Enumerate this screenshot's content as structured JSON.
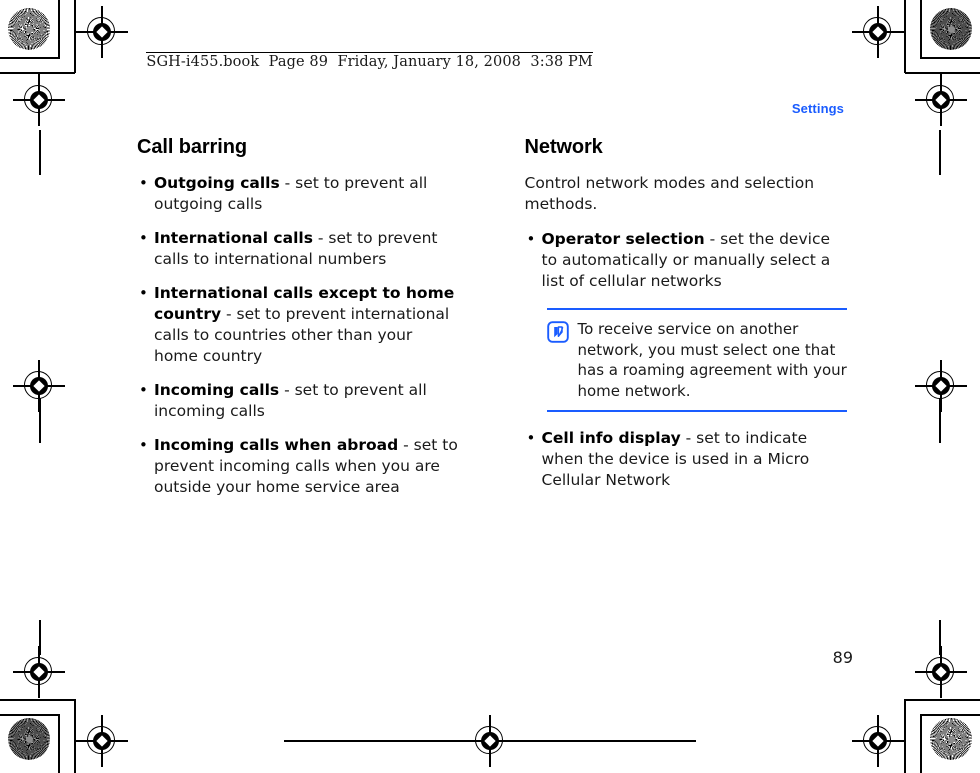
{
  "page": {
    "book_header": "SGH-i455.book  Page 89  Friday, January 18, 2008  3:38 PM",
    "section_label": "Settings",
    "folio": "89"
  },
  "columns": [
    {
      "title": "Call barring",
      "bullets": [
        {
          "term": "Outgoing calls",
          "rest": " - set to prevent all outgoing calls"
        },
        {
          "term": "International calls",
          "rest": " - set to prevent calls to international numbers"
        },
        {
          "term": "International calls except to home country",
          "rest": " - set to prevent international calls to countries other than your home country"
        },
        {
          "term": "Incoming calls",
          "rest": " - set to prevent all incoming calls"
        },
        {
          "term": "Incoming calls when abroad",
          "rest": " - set to prevent incoming calls when you are outside your home service area"
        }
      ]
    },
    {
      "title": "Network",
      "intro": "Control network modes and selection methods.",
      "bullets_before_note": [
        {
          "term": "Operator selection",
          "rest": " - set the device to automatically or manually select a list of cellular networks"
        }
      ],
      "note": {
        "icon": "note-pen-icon",
        "text": "To receive service on another network, you must select one that has a roaming agreement with your home network."
      },
      "bullets_after_note": [
        {
          "term": "Cell info display",
          "rest": " - set to indicate when the device is used in a Micro Cellular Network"
        }
      ]
    }
  ],
  "colors": {
    "accent_blue": "#1a5cff",
    "note_rule": "#1a5cff",
    "text": "#1a1a1a"
  }
}
